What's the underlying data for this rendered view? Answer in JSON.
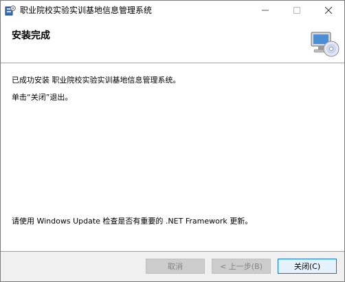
{
  "window": {
    "title": "职业院校实验实训基地信息管理系统",
    "controls": {
      "minimize": "—",
      "maximize": "☐",
      "close": "✕"
    }
  },
  "header": {
    "title": "安装完成",
    "icon": "installer-computer-cd-icon"
  },
  "content": {
    "line1": "已成功安装 职业院校实验实训基地信息管理系统。",
    "line2": "单击“关闭”退出。",
    "line3": "请使用 Windows Update 检查是否有重要的 .NET Framework 更新。"
  },
  "buttons": {
    "cancel": "取消",
    "back": "< 上一步(B)",
    "finish": "关闭(C)"
  },
  "colors": {
    "footer_bg": "#f0f0f0",
    "accent_border": "#0078d7",
    "disabled_button_bg": "#cccccc"
  }
}
